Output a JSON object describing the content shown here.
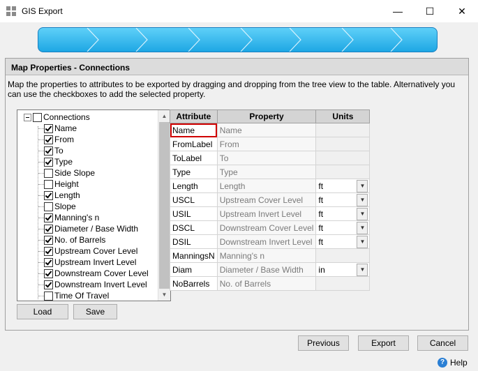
{
  "window": {
    "title": "GIS Export",
    "minimize": "—",
    "maximize": "☐",
    "close": "✕"
  },
  "section": {
    "title": "Map Properties - Connections"
  },
  "instructions": "Map the properties to attributes to be exported by dragging and dropping from the tree view to the table. Alternatively you can use the checkboxes to add the selected property.",
  "tree": {
    "root": {
      "label": "Connections",
      "checked": false
    },
    "items": [
      {
        "label": "Name",
        "checked": true
      },
      {
        "label": "From",
        "checked": true
      },
      {
        "label": "To",
        "checked": true
      },
      {
        "label": "Type",
        "checked": true
      },
      {
        "label": "Side Slope",
        "checked": false
      },
      {
        "label": "Height",
        "checked": false
      },
      {
        "label": "Length",
        "checked": true
      },
      {
        "label": "Slope",
        "checked": false
      },
      {
        "label": "Manning's n",
        "checked": true
      },
      {
        "label": "Diameter / Base Width",
        "checked": true
      },
      {
        "label": "No. of Barrels",
        "checked": true
      },
      {
        "label": "Upstream Cover Level",
        "checked": true
      },
      {
        "label": "Upstream Invert Level",
        "checked": true
      },
      {
        "label": "Downstream Cover Level",
        "checked": true
      },
      {
        "label": "Downstream Invert Level",
        "checked": true
      },
      {
        "label": "Time Of Travel",
        "checked": false
      }
    ]
  },
  "buttons": {
    "load": "Load",
    "save": "Save",
    "previous": "Previous",
    "export": "Export",
    "cancel": "Cancel",
    "help": "Help"
  },
  "table": {
    "headers": [
      "Attribute",
      "Property",
      "Units"
    ],
    "rows": [
      {
        "attribute": "Name",
        "property": "Name",
        "units": ""
      },
      {
        "attribute": "FromLabel",
        "property": "From",
        "units": ""
      },
      {
        "attribute": "ToLabel",
        "property": "To",
        "units": ""
      },
      {
        "attribute": "Type",
        "property": "Type",
        "units": ""
      },
      {
        "attribute": "Length",
        "property": "Length",
        "units": "ft"
      },
      {
        "attribute": "USCL",
        "property": "Upstream Cover Level",
        "units": "ft"
      },
      {
        "attribute": "USIL",
        "property": "Upstream Invert Level",
        "units": "ft"
      },
      {
        "attribute": "DSCL",
        "property": "Downstream Cover Level",
        "units": "ft"
      },
      {
        "attribute": "DSIL",
        "property": "Downstream Invert Level",
        "units": "ft"
      },
      {
        "attribute": "ManningsN",
        "property": "Manning's n",
        "units": ""
      },
      {
        "attribute": "Diam",
        "property": "Diameter / Base Width",
        "units": "in"
      },
      {
        "attribute": "NoBarrels",
        "property": "No. of Barrels",
        "units": ""
      }
    ]
  }
}
